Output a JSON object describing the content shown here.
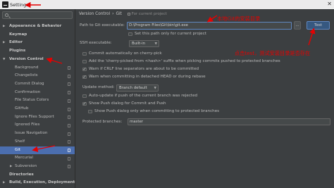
{
  "window": {
    "title": "Settings"
  },
  "sidebar": {
    "search_placeholder": "",
    "items": [
      {
        "label": "Appearance & Behavior",
        "arrow": "▶",
        "bold": true
      },
      {
        "label": "Keymap",
        "arrow": "",
        "bold": true
      },
      {
        "label": "Editor",
        "arrow": "▶",
        "bold": true
      },
      {
        "label": "Plugins",
        "arrow": "",
        "bold": true
      },
      {
        "label": "Version Control",
        "arrow": "▼",
        "bold": true
      },
      {
        "label": "Background"
      },
      {
        "label": "Changelists"
      },
      {
        "label": "Commit Dialog"
      },
      {
        "label": "Confirmation"
      },
      {
        "label": "File Status Colors"
      },
      {
        "label": "GitHub"
      },
      {
        "label": "Ignore Files Support"
      },
      {
        "label": "Ignored Files"
      },
      {
        "label": "Issue Navigation"
      },
      {
        "label": "Shelf"
      },
      {
        "label": "Git",
        "selected": true
      },
      {
        "label": "Mercurial"
      },
      {
        "label": "Subversion",
        "arrow": "▶"
      },
      {
        "label": "Directories",
        "bold": true
      },
      {
        "label": "Build, Execution, Deployment",
        "arrow": "▶",
        "bold": true
      }
    ]
  },
  "breadcrumb": {
    "part1": "Version Control",
    "separator": "›",
    "part2": "Git",
    "project": "For current project"
  },
  "git": {
    "path_label": "Path to Git executable:",
    "path_value": "D:\\Program Files\\Git\\bin\\git.exe",
    "browse_label": "...",
    "test_label": "Test",
    "set_path_label": "Set this path only for current project",
    "ssh_label": "SSH executable:",
    "ssh_value": "Built-in",
    "options": [
      {
        "label": "Commit automatically on cherry-pick",
        "checked": false
      },
      {
        "label": "Add the 'cherry-picked from <hash>' suffix when picking commits pushed to protected branches",
        "checked": false
      },
      {
        "label": "Warn if CRLF line separators are about to be committed",
        "checked": true
      },
      {
        "label": "Warn when committing in detached HEAD or during rebase",
        "checked": true
      }
    ],
    "update_label": "Update method:",
    "update_value": "Branch default",
    "auto_update_label": "Auto-update if push of the current branch was rejected",
    "show_push_label": "Show Push dialog for Commit and Push",
    "show_push_only_label": "Show Push dialog only when committing to protected branches",
    "protected_label": "Protected branches:",
    "protected_value": "master"
  },
  "annotations": {
    "local_git": "本地Git的安装目录",
    "click_test": "点击test，测试安装目录是否存在"
  },
  "colors": {
    "annotation": "#e60000",
    "selection": "#4b6eaf"
  }
}
